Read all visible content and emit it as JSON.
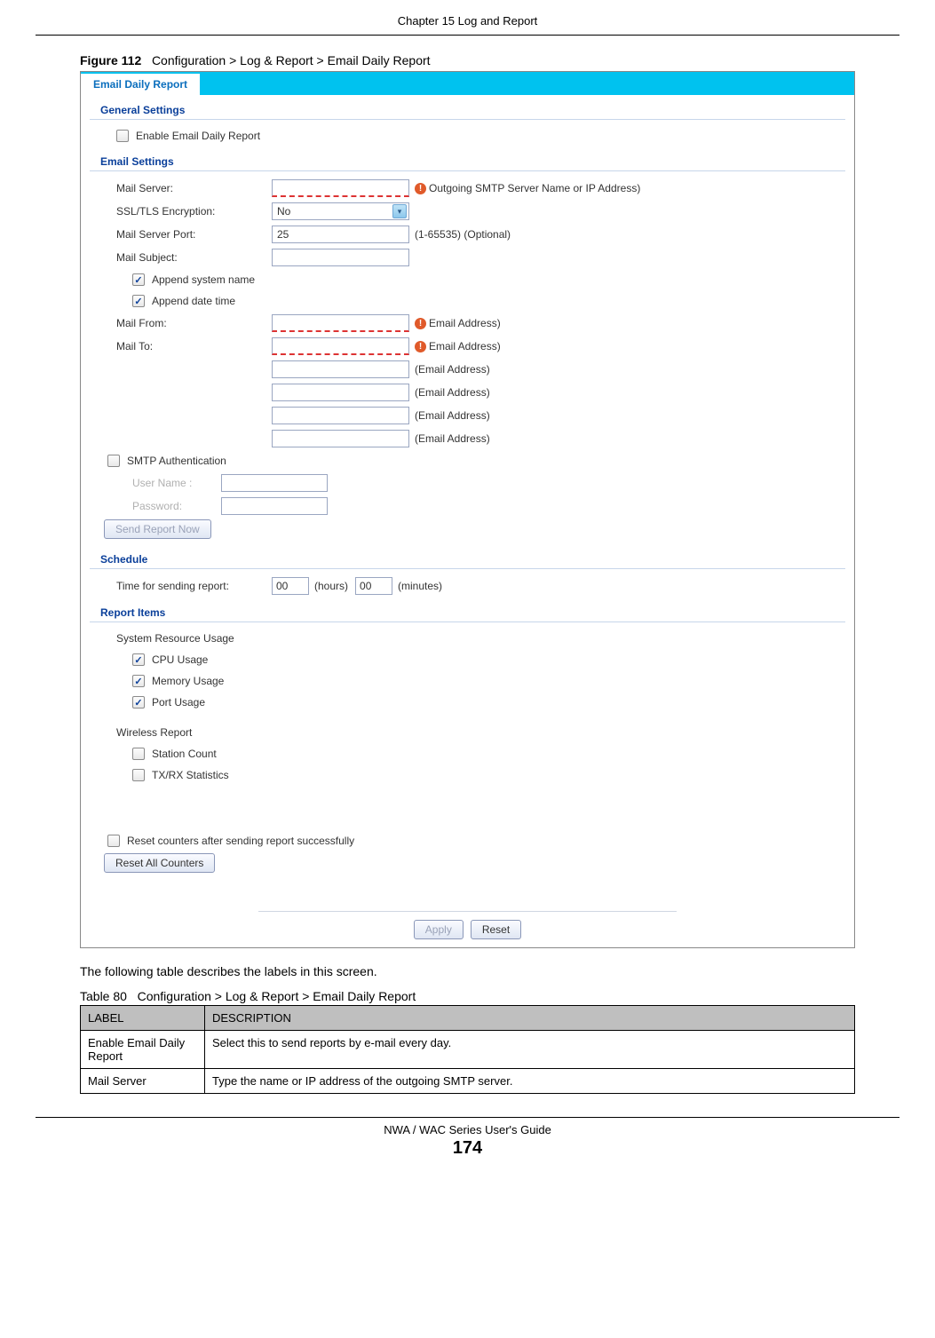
{
  "chapter_header": "Chapter 15 Log and Report",
  "figure": {
    "number": "Figure 112",
    "caption": "Configuration > Log & Report > Email Daily Report"
  },
  "panel": {
    "tab": "Email Daily Report",
    "sections": {
      "general": {
        "title": "General Settings",
        "enable_label": "Enable Email Daily Report"
      },
      "email": {
        "title": "Email Settings",
        "mail_server": "Mail Server:",
        "mail_server_hint": "Outgoing SMTP Server Name or IP Address)",
        "ssl": "SSL/TLS Encryption:",
        "ssl_value": "No",
        "port": "Mail Server Port:",
        "port_value": "25",
        "port_hint": "(1-65535) (Optional)",
        "subject": "Mail Subject:",
        "append_sys": "Append system name",
        "append_date": "Append date time",
        "from": "Mail From:",
        "from_hint": "Email Address)",
        "to": "Mail To:",
        "to_hint1": "Email Address)",
        "to_hint2": "(Email Address)",
        "to_hint3": "(Email Address)",
        "to_hint4": "(Email Address)",
        "to_hint5": "(Email Address)",
        "smtp_auth": "SMTP Authentication",
        "user": "User Name :",
        "pass": "Password:",
        "send_now": "Send Report Now"
      },
      "schedule": {
        "title": "Schedule",
        "time_label": "Time for sending report:",
        "hours_val": "00",
        "hours": "(hours)",
        "minutes_val": "00",
        "minutes": "(minutes)"
      },
      "report_items": {
        "title": "Report Items",
        "sys_usage": "System Resource Usage",
        "cpu": "CPU Usage",
        "mem": "Memory Usage",
        "port": "Port Usage",
        "wireless": "Wireless Report",
        "station": "Station Count",
        "txrx": "TX/RX Statistics",
        "reset_counters": "Reset counters after sending report successfully",
        "reset_all": "Reset All Counters"
      }
    },
    "footer": {
      "apply": "Apply",
      "reset": "Reset"
    }
  },
  "body_text": "The following table describes the labels in this screen.",
  "table": {
    "caption_num": "Table 80",
    "caption": "Configuration > Log & Report > Email Daily Report",
    "headers": {
      "label": "LABEL",
      "desc": "DESCRIPTION"
    },
    "rows": [
      {
        "label": "Enable Email Daily Report",
        "desc": "Select this to send reports by e-mail every day."
      },
      {
        "label": "Mail Server",
        "desc": "Type the name or IP address of the outgoing SMTP server."
      }
    ]
  },
  "footer": {
    "guide": "NWA / WAC Series User's Guide",
    "page": "174"
  }
}
